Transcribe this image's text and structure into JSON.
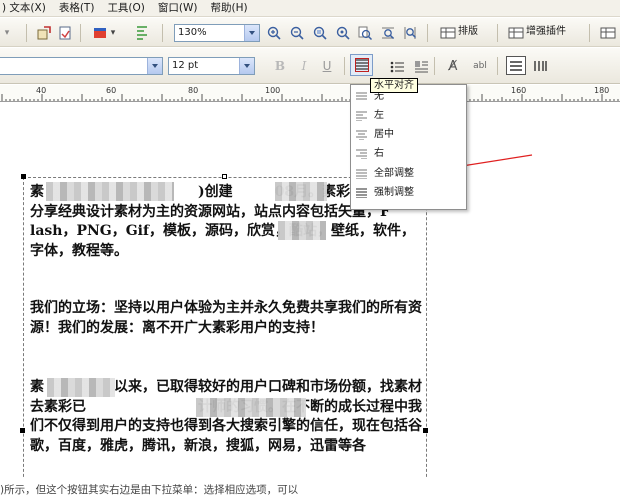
{
  "menubar": {
    "items": [
      ") 文本(X)",
      "表格(T)",
      "工具(O)",
      "窗口(W)",
      "帮助(H)"
    ]
  },
  "toolbar": {
    "zoom_value": "130%",
    "layout_label": "排版",
    "plugin_label": "增强插件",
    "font_size_value": "12 pt"
  },
  "ruler": {
    "labels": [
      "40",
      "60",
      "80",
      "100",
      "160",
      "180"
    ]
  },
  "align_dropdown": {
    "tooltip": "水平对齐",
    "items": [
      {
        "label": "无",
        "icon": "align-none-icon"
      },
      {
        "label": "左",
        "icon": "align-left-icon"
      },
      {
        "label": "居中",
        "icon": "align-center-icon"
      },
      {
        "label": "右",
        "icon": "align-right-icon"
      },
      {
        "label": "全部调整",
        "icon": "align-justify-icon"
      },
      {
        "label": "强制调整",
        "icon": "align-force-justify-icon"
      }
    ]
  },
  "document": {
    "paragraphs": [
      "素　　　　　　　　　　　)创建　　　08月。素彩网是一个以分享经典设计素材为主的资源网站，站点内容包括矢量，F　　　　lash，PNG，Gif，模板，源码，欣赏，酷站，壁纸，软件，字体，教程等。",
      "我们的立场：坚持以用户体验为主并永久免费共享我们的所有资源！我们的发展：离不开广大素彩用户的支持！",
      "素　　　　　以来，已取得较好的用户口碑和市场份额，找素材去素彩已　　　　　　　　计师的习惯。在不断的成长过程中我们不仅得到用户的支持也得到各大搜索引擎的信任，现在包括谷歌，百度，雅虎，腾讯，新浪，搜狐，网易，迅雷等各"
    ]
  },
  "caption": {
    "text": ")所示，但这个按钮其实右边是由下拉菜单：选择相应选项，可以"
  },
  "colors": {
    "annotation_arrow": "#e02020",
    "menu_highlight": "#316ac5"
  }
}
